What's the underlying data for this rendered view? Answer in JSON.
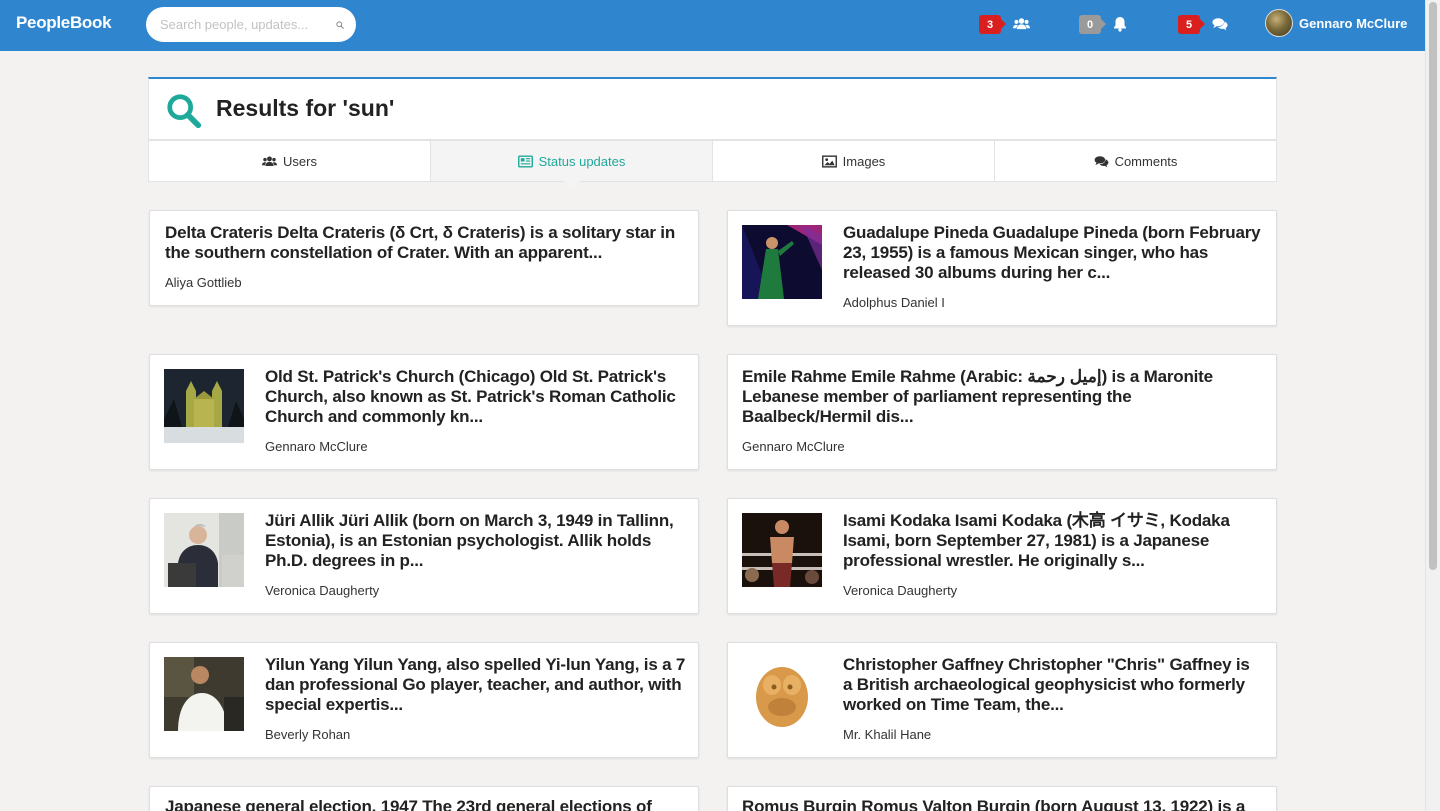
{
  "app": {
    "brand": "PeopleBook"
  },
  "search": {
    "placeholder": "Search people, updates..."
  },
  "nav": {
    "friends_count": "3",
    "notifications_count": "0",
    "messages_count": "5",
    "user_name": "Gennaro McClure"
  },
  "results": {
    "title": "Results for 'sun'"
  },
  "tabs": [
    {
      "label": "Users",
      "icon": "users-icon",
      "active": false
    },
    {
      "label": "Status updates",
      "icon": "newspaper-icon",
      "active": true
    },
    {
      "label": "Images",
      "icon": "image-icon",
      "active": false
    },
    {
      "label": "Comments",
      "icon": "comments-icon",
      "active": false
    }
  ],
  "cards": [
    {
      "title": "Delta Crateris Delta Crateris (δ Crt, δ Crateris) is a solitary star in the southern constellation of Crater. With an apparent...",
      "author": "Aliya Gottlieb",
      "has_thumb": false
    },
    {
      "title": "Guadalupe Pineda Guadalupe Pineda (born February 23, 1955) is a famous Mexican singer, who has released 30 albums during her c...",
      "author": "Adolphus Daniel I",
      "has_thumb": true,
      "thumb": "singer-on-stage-photo"
    },
    {
      "title": "Old St. Patrick's Church (Chicago) Old St. Patrick's Church, also known as St. Patrick's Roman Catholic Church and commonly kn...",
      "author": "Gennaro McClure",
      "has_thumb": true,
      "thumb": "church-at-night-photo"
    },
    {
      "title": "Emile Rahme Emile Rahme (Arabic: إميل رحمة) is a Maronite Lebanese member of parliament representing the Baalbeck/Hermil dis...",
      "author": "Gennaro McClure",
      "has_thumb": false
    },
    {
      "title": "Jüri Allik Jüri Allik (born on March 3, 1949 in Tallinn, Estonia), is an Estonian psychologist. Allik holds Ph.D. degrees in p...",
      "author": "Veronica Daugherty",
      "has_thumb": true,
      "thumb": "man-at-podium-photo"
    },
    {
      "title": "Isami Kodaka Isami Kodaka (木高 イサミ, Kodaka Isami, born September 27, 1981) is a Japanese professional wrestler. He originally s...",
      "author": "Veronica Daugherty",
      "has_thumb": true,
      "thumb": "wrestler-in-ring-photo"
    },
    {
      "title": "Yilun Yang Yilun Yang, also spelled Yi-lun Yang, is a 7 dan professional Go player, teacher, and author, with special expertis...",
      "author": "Beverly Rohan",
      "has_thumb": true,
      "thumb": "man-in-white-shirt-photo"
    },
    {
      "title": "Christopher Gaffney Christopher \"Chris\" Gaffney is a British archaeological geophysicist who formerly worked on Time Team, the...",
      "author": "Mr. Khalil Hane",
      "has_thumb": true,
      "thumb": "clay-figure-photo"
    },
    {
      "title": "Japanese general election, 1947 The 23rd general elections of",
      "author": "",
      "has_thumb": false
    },
    {
      "title": "Romus Burgin Romus Valton Burgin (born August 13, 1922) is a",
      "author": "",
      "has_thumb": false
    }
  ],
  "colors": {
    "navbar": "#2f86cf",
    "accent": "#1fa99a",
    "badge_red": "#d9201f",
    "badge_gray": "#9a9a9a"
  }
}
